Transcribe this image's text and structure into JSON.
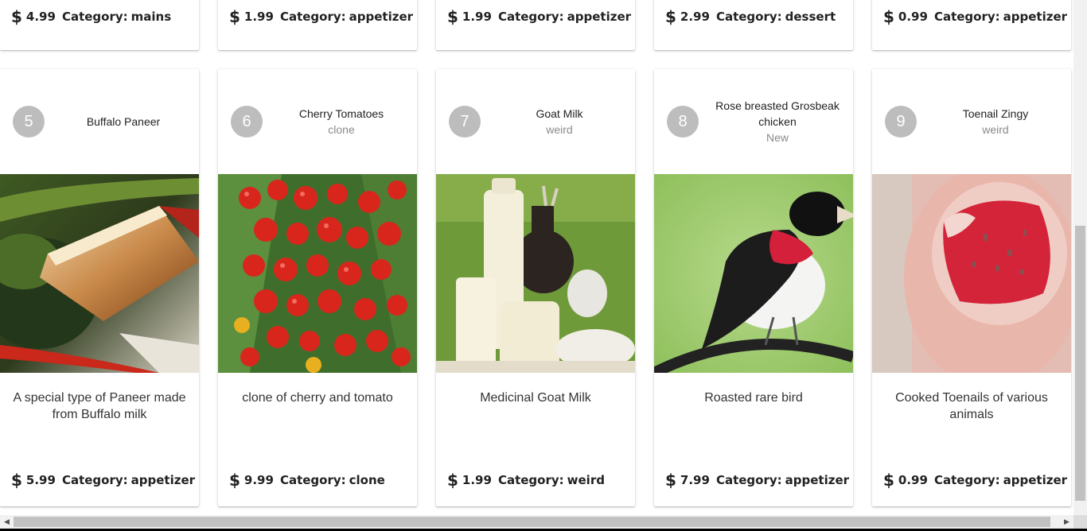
{
  "top_cards": [
    {
      "price": "4.99",
      "category_label": "Category:",
      "category": "mains"
    },
    {
      "price": "1.99",
      "category_label": "Category:",
      "category": "appetizer"
    },
    {
      "price": "1.99",
      "category_label": "Category:",
      "category": "appetizer"
    },
    {
      "price": "2.99",
      "category_label": "Category:",
      "category": "dessert"
    },
    {
      "price": "0.99",
      "category_label": "Category:",
      "category": "appetizer"
    }
  ],
  "cards": [
    {
      "avatar": "5",
      "title": "Buffalo Paneer",
      "subtitle": "",
      "image": "paneer-image",
      "description": "A special type of Paneer made from Buffalo milk",
      "price": "5.99",
      "category_label": "Category:",
      "category": "appetizer"
    },
    {
      "avatar": "6",
      "title": "Cherry Tomatoes",
      "subtitle": "clone",
      "image": "cherry-tomatoes-image",
      "description": "clone of cherry and tomato",
      "price": "9.99",
      "category_label": "Category:",
      "category": "clone"
    },
    {
      "avatar": "7",
      "title": "Goat Milk",
      "subtitle": "weird",
      "image": "goat-milk-image",
      "description": "Medicinal Goat Milk",
      "price": "1.99",
      "category_label": "Category:",
      "category": "weird"
    },
    {
      "avatar": "8",
      "title": "Rose breasted Grosbeak chicken",
      "subtitle": "New",
      "image": "grosbeak-image",
      "description": "Roasted rare bird",
      "price": "7.99",
      "category_label": "Category:",
      "category": "appetizer"
    },
    {
      "avatar": "9",
      "title": "Toenail Zingy",
      "subtitle": "weird",
      "image": "toenail-image",
      "description": "Cooked Toenails of various animals",
      "price": "0.99",
      "category_label": "Category:",
      "category": "appetizer"
    }
  ],
  "currency_symbol": "$",
  "icons": {
    "scroll_left": "scroll-left-arrow-icon",
    "scroll_right": "scroll-right-arrow-icon"
  }
}
